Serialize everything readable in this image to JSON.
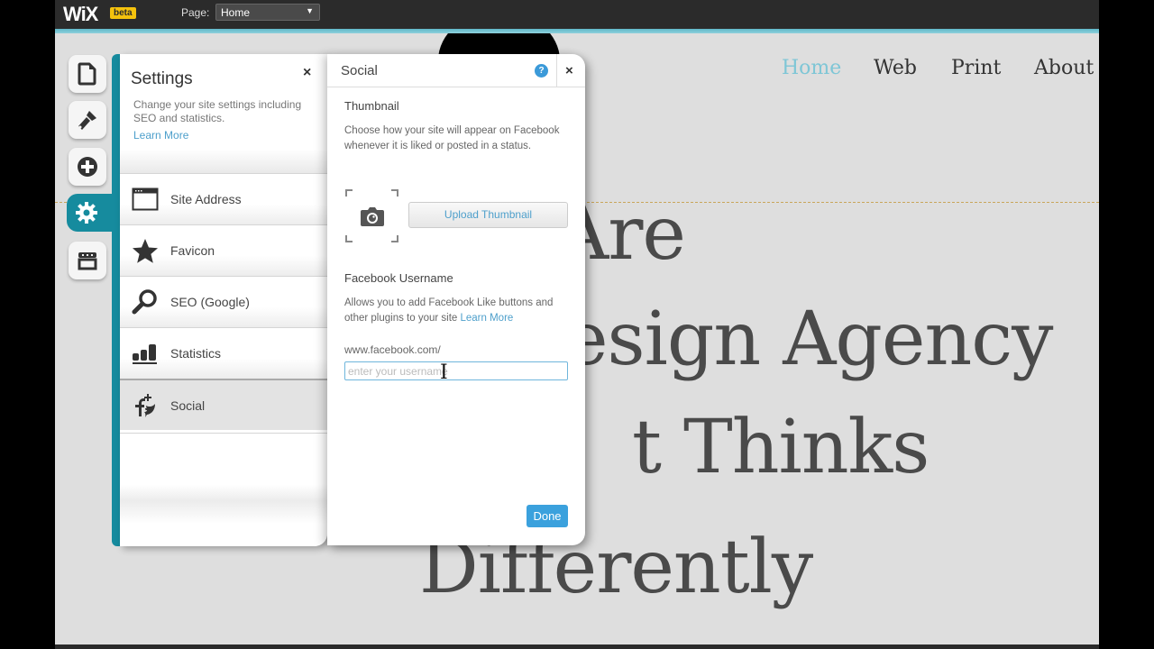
{
  "topbar": {
    "logo": "WiX",
    "badge": "beta",
    "page_label": "Page:",
    "page_selected": "Home"
  },
  "site": {
    "nav": [
      "Home",
      "Web",
      "Print",
      "About"
    ],
    "active_nav": "Home",
    "headline_lines": [
      "Are",
      "esign Agency",
      "t Thinks",
      "Differently"
    ]
  },
  "toolbar": {
    "items": [
      {
        "icon": "pages-icon",
        "label": "Pages"
      },
      {
        "icon": "design-brush-icon",
        "label": "Design"
      },
      {
        "icon": "add-icon",
        "label": "Add"
      },
      {
        "icon": "settings-gear-icon",
        "label": "Settings",
        "active": true
      },
      {
        "icon": "store-icon",
        "label": "App Market"
      }
    ]
  },
  "settings": {
    "title": "Settings",
    "close": "×",
    "description": "Change your site settings including SEO and statistics.",
    "learn_more": "Learn More",
    "items": [
      {
        "label": "Site Address",
        "icon": "browser-window-icon"
      },
      {
        "label": "Favicon",
        "icon": "star-icon"
      },
      {
        "label": "SEO (Google)",
        "icon": "magnifier-icon"
      },
      {
        "label": "Statistics",
        "icon": "bar-chart-icon"
      },
      {
        "label": "Social",
        "icon": "social-icon",
        "active": true
      }
    ]
  },
  "social": {
    "title": "Social",
    "help": "?",
    "close": "×",
    "thumbnail": {
      "title": "Thumbnail",
      "description": "Choose how your site will appear on Facebook whenever it is liked or posted in a status.",
      "upload_label": "Upload Thumbnail"
    },
    "facebook": {
      "title": "Facebook Username",
      "description": "Allows you to add Facebook Like buttons and other plugins to your site",
      "learn_more": "Learn More",
      "prefix": "www.facebook.com/",
      "value": "",
      "placeholder": "enter your username"
    },
    "done_label": "Done"
  },
  "colors": {
    "accent_teal": "#168b9e",
    "link_blue": "#4d9fcb",
    "done_blue": "#3ba1dd",
    "nav_active": "#7ec6d6",
    "beta_yellow": "#f4c20d"
  }
}
